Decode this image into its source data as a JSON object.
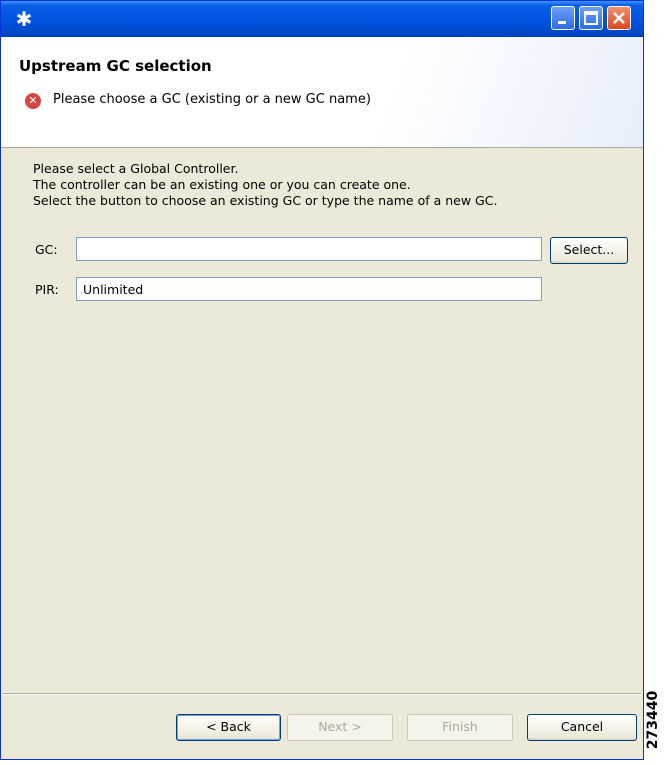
{
  "window": {
    "app_icon": "eclipse-star-icon",
    "controls": [
      "minimize-icon",
      "maximize-icon",
      "close-icon"
    ]
  },
  "header": {
    "title": "Upstream GC selection",
    "status_icon": "error-icon",
    "message": "Please choose a GC (existing or a new GC name)"
  },
  "instructions": [
    "Please select a Global Controller.",
    "The controller can be an existing one or you can create one.",
    "Select the button to choose an existing GC or type the name of a new GC."
  ],
  "form": {
    "gc_label": "GC:",
    "gc_value": "",
    "select_label": "Select...",
    "pir_label": "PIR:",
    "pir_value": "Unlimited"
  },
  "footer": {
    "back": "< Back",
    "next": "Next >",
    "finish": "Finish",
    "cancel": "Cancel"
  },
  "figure_number": "273440",
  "colors": {
    "titlebar": "#0054e3",
    "dialog_bg": "#ece9d8",
    "error": "#d64545"
  }
}
